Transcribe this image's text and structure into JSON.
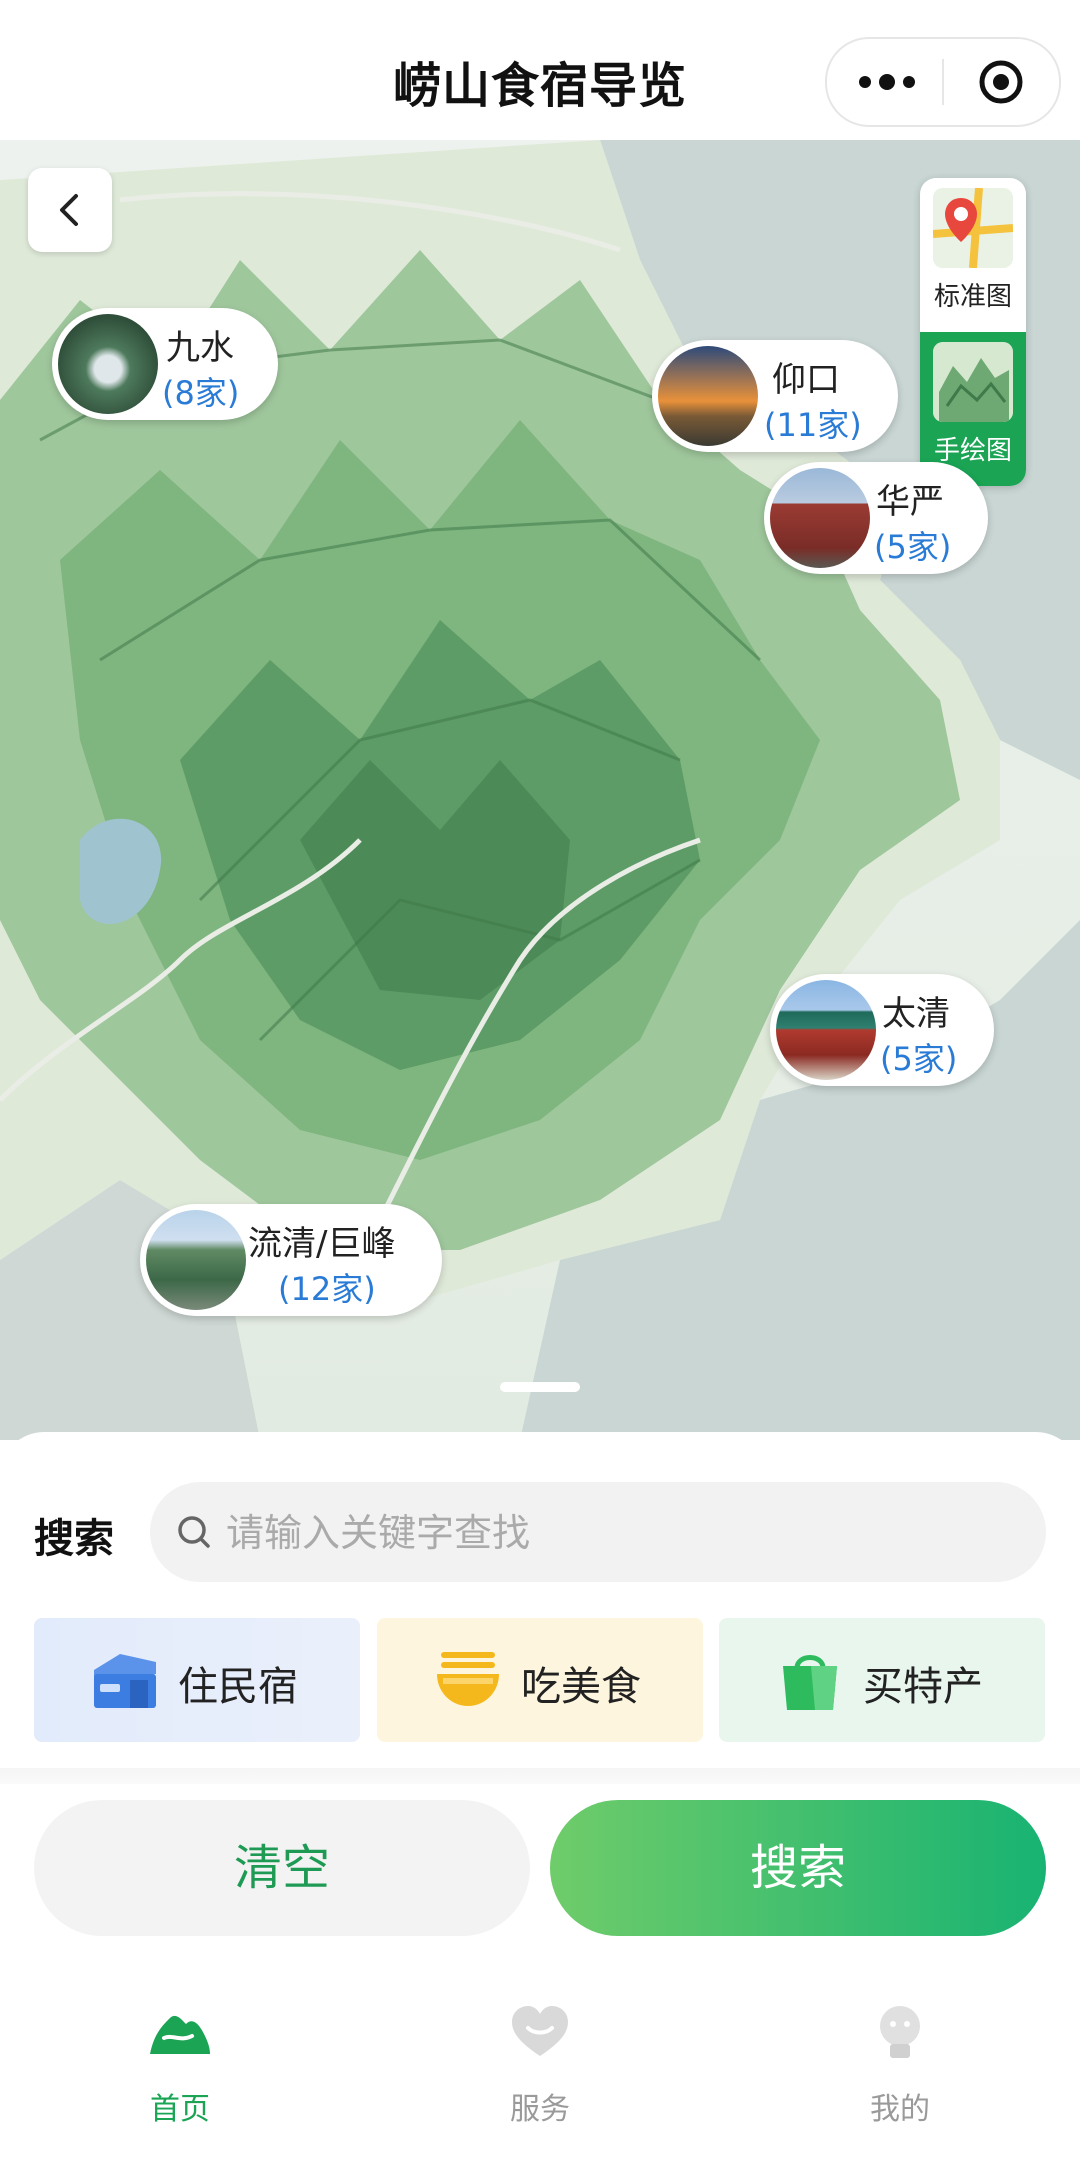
{
  "header": {
    "title": "崂山食宿导览"
  },
  "map": {
    "toggle": [
      {
        "label": "标准图",
        "active": false
      },
      {
        "label": "手绘图",
        "active": true
      }
    ],
    "pois": [
      {
        "name": "九水",
        "count": "(8家)"
      },
      {
        "name": "仰口",
        "count": "(11家)"
      },
      {
        "name": "华严",
        "count": "(5家)"
      },
      {
        "name": "太清",
        "count": "(5家)"
      },
      {
        "name": "流清/巨峰",
        "count": "(12家)"
      }
    ]
  },
  "search": {
    "label": "搜索",
    "placeholder": "请输入关键字查找",
    "value": ""
  },
  "categories": [
    {
      "label": "住民宿",
      "icon": "house-icon",
      "color": "#3b7de0"
    },
    {
      "label": "吃美食",
      "icon": "food-bowl-icon",
      "color": "#f5b81c"
    },
    {
      "label": "买特产",
      "icon": "shopping-bag-icon",
      "color": "#2dbb5d"
    }
  ],
  "actions": {
    "clear": "清空",
    "search": "搜索"
  },
  "tabbar": [
    {
      "label": "首页",
      "icon": "mountain-icon",
      "active": true
    },
    {
      "label": "服务",
      "icon": "heart-icon",
      "active": false
    },
    {
      "label": "我的",
      "icon": "user-icon",
      "active": false
    }
  ],
  "colors": {
    "accent": "#1aa454",
    "link": "#2a7bd6"
  }
}
